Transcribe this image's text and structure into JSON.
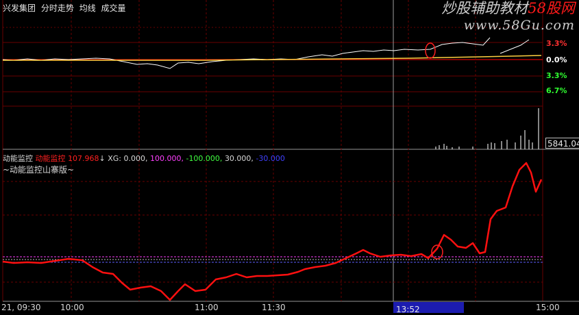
{
  "title_bar": {
    "stock_name": "兴发集团",
    "mode": "分时走势",
    "avg_line": "均线",
    "volume": "成交量"
  },
  "watermark": {
    "main_text": "炒股辅助教材",
    "brand_red": "58股网",
    "url": "www.58Gu.com"
  },
  "price_axis": {
    "labels": [
      {
        "text": "3.3%",
        "color": "#ff3030"
      },
      {
        "text": "0.0%",
        "color": "#ffffff"
      },
      {
        "text": "3.3%",
        "color": "#30ff30"
      },
      {
        "text": "6.7%",
        "color": "#30ff30"
      }
    ]
  },
  "volume_panel": {
    "current_value": "5841.04"
  },
  "indicator": {
    "name": "动能监控",
    "line_name": "动能监控",
    "line_value": "107.968",
    "arrow": "↓",
    "xg_label": "XG:",
    "xg_value": "0.000,",
    "level_100": "100.000,",
    "level_neg100": "-100.000,",
    "level_30": "30.000,",
    "level_neg30": "-30.000",
    "subtitle": "~动能监控山寨版~"
  },
  "time_axis": {
    "labels": [
      "21, 09:30",
      "10:00",
      "11:00",
      "11:30",
      "15:00"
    ],
    "cursor_time": "13:52"
  },
  "colors": {
    "background": "#000000",
    "grid": "#6a0000",
    "indicator_line": "#ff1010",
    "price_line": "#ffffff",
    "avg_line": "#ffd040",
    "cursor_bg": "#1c1cb0",
    "annotation": "#ff2020"
  }
}
